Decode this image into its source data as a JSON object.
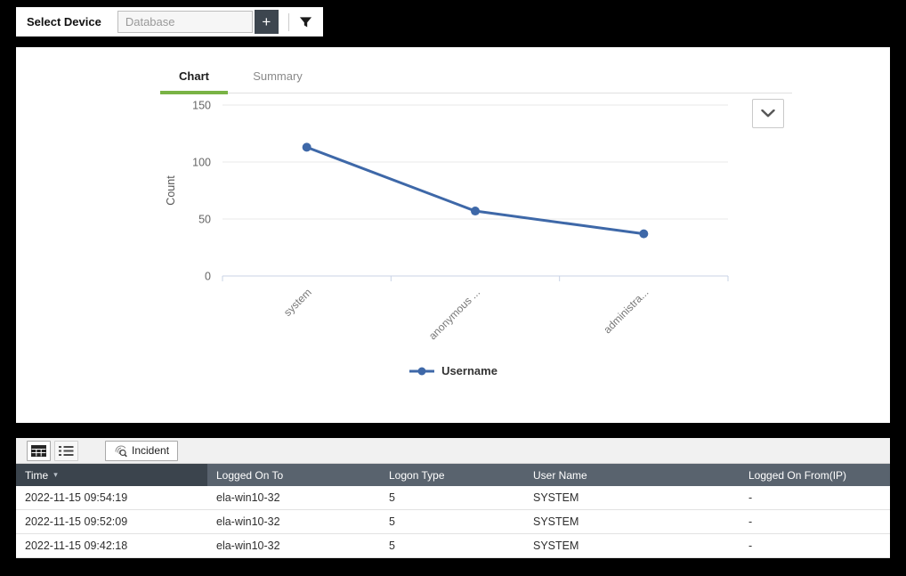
{
  "topbar": {
    "label": "Select Device",
    "input_placeholder": "Database",
    "add_button_label": "+",
    "filter_icon": "funnel-icon"
  },
  "chart_panel": {
    "tabs": [
      {
        "label": "Chart",
        "active": true
      },
      {
        "label": "Summary",
        "active": false
      }
    ],
    "collapse_icon": "chevron-down-icon",
    "legend_label": "Username"
  },
  "chart_data": {
    "type": "line",
    "title": "",
    "xlabel": "",
    "ylabel": "Count",
    "categories": [
      "system",
      "anonymous ...",
      "administra..."
    ],
    "series": [
      {
        "name": "Username",
        "values": [
          113,
          57,
          37
        ]
      }
    ],
    "ylim": [
      0,
      150
    ],
    "yticks": [
      0,
      50,
      100,
      150
    ],
    "grid": true,
    "legend_position": "bottom",
    "marker": "circle"
  },
  "table_panel": {
    "toolbar": {
      "grid_view_icon": "table-grid-icon",
      "list_view_icon": "list-icon",
      "incident_icon": "incident-search-icon",
      "incident_label": "Incident"
    },
    "columns": [
      "Time",
      "Logged On To",
      "Logon Type",
      "User Name",
      "Logged On From(IP)"
    ],
    "sort_column": "Time",
    "sort_icon": "▾",
    "rows": [
      [
        "2022-11-15 09:54:19",
        "ela-win10-32",
        "5",
        "SYSTEM",
        "-"
      ],
      [
        "2022-11-15 09:52:09",
        "ela-win10-32",
        "5",
        "SYSTEM",
        "-"
      ],
      [
        "2022-11-15 09:42:18",
        "ela-win10-32",
        "5",
        "SYSTEM",
        "-"
      ]
    ]
  },
  "colors": {
    "accent_green": "#79b345",
    "line_blue": "#3e68a8",
    "header_dark": "#3b444d",
    "header_light": "#59636e",
    "button_dark": "#3d464f"
  }
}
